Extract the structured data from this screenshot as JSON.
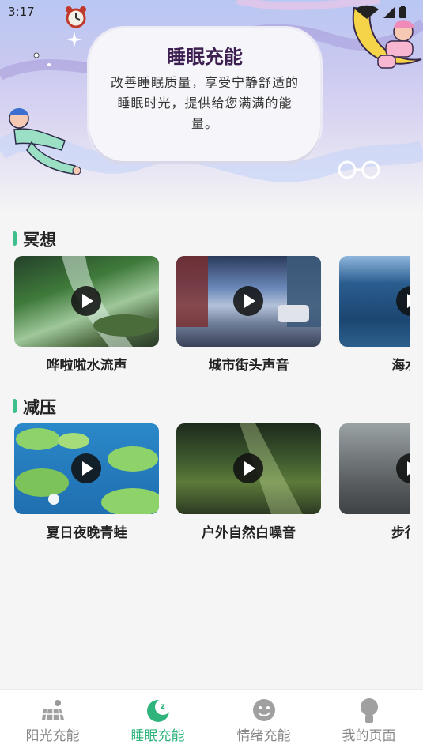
{
  "status_bar": {
    "time": "3:17"
  },
  "hero": {
    "title": "睡眠充能",
    "description": "改善睡眠质量，享受宁静舒适的睡眠时光，提供给您满满的能量。"
  },
  "sections": [
    {
      "title": "冥想",
      "items": [
        {
          "label": "哗啦啦水流声",
          "icon": "play-icon"
        },
        {
          "label": "城市街头声音",
          "icon": "play-icon"
        },
        {
          "label": "海水涌",
          "icon": "play-icon"
        }
      ]
    },
    {
      "title": "减压",
      "items": [
        {
          "label": "夏日夜晚青蛙",
          "icon": "play-icon"
        },
        {
          "label": "户外自然白噪音",
          "icon": "play-icon"
        },
        {
          "label": "步行沙",
          "icon": "play-icon"
        }
      ]
    }
  ],
  "tabs": [
    {
      "label": "阳光充能",
      "icon": "solar-panel-icon",
      "active": false
    },
    {
      "label": "睡眠充能",
      "icon": "moon-sleep-icon",
      "active": true
    },
    {
      "label": "情绪充能",
      "icon": "smile-face-icon",
      "active": false
    },
    {
      "label": "我的页面",
      "icon": "user-icon",
      "active": false
    }
  ],
  "colors": {
    "accent": "#2fb47c",
    "section_bar": "#3cbf8a",
    "title_purple": "#3d1f52",
    "inactive_tab": "#888888"
  }
}
